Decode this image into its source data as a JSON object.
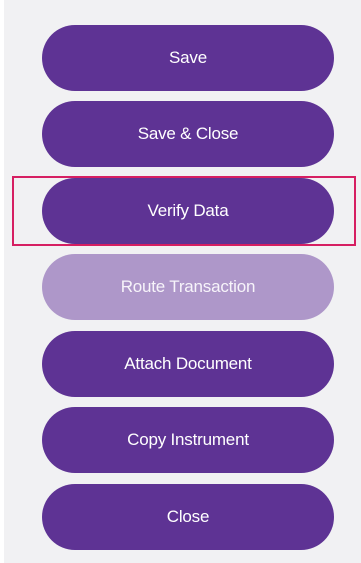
{
  "actions": {
    "buttons": [
      {
        "id": "save",
        "label": "Save",
        "enabled": true
      },
      {
        "id": "save-close",
        "label": "Save & Close",
        "enabled": true
      },
      {
        "id": "verify-data",
        "label": "Verify Data",
        "enabled": true,
        "highlighted": true
      },
      {
        "id": "route-transaction",
        "label": "Route Transaction",
        "enabled": false
      },
      {
        "id": "attach-document",
        "label": "Attach Document",
        "enabled": true
      },
      {
        "id": "copy-instrument",
        "label": "Copy Instrument",
        "enabled": true
      },
      {
        "id": "close",
        "label": "Close",
        "enabled": true
      }
    ]
  },
  "colors": {
    "button_bg": "#5e3394",
    "button_disabled_bg": "#ae97c9",
    "highlight_border": "#d61f62",
    "panel_bg": "#f1f1f3"
  }
}
